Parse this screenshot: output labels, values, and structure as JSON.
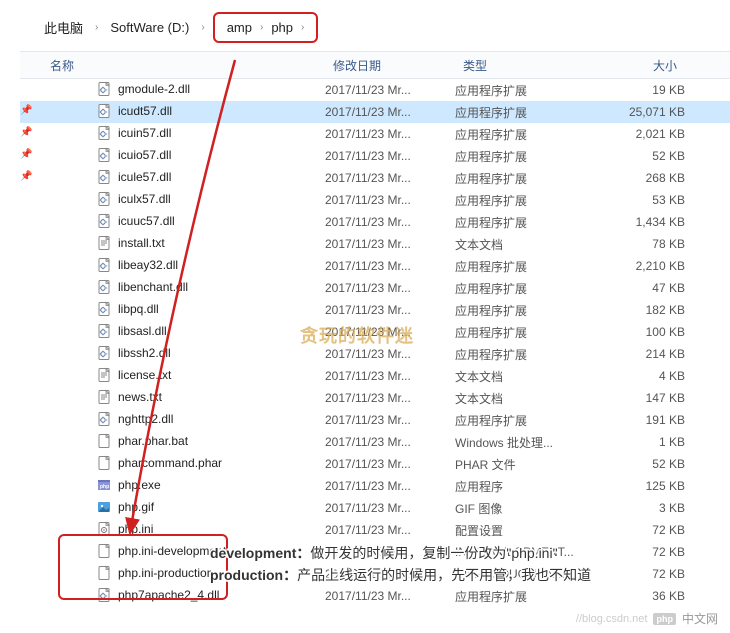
{
  "breadcrumb": {
    "items": [
      "此电脑",
      "SoftWare (D:)",
      "amp",
      "php"
    ]
  },
  "columns": {
    "name": "名称",
    "date": "修改日期",
    "type": "类型",
    "size": "大小"
  },
  "files": [
    {
      "pin": false,
      "icon": "dll",
      "name": "gmodule-2.dll",
      "date": "2017/11/23 Mr...",
      "type": "应用程序扩展",
      "size": "19 KB",
      "selected": false
    },
    {
      "pin": true,
      "icon": "dll",
      "name": "icudt57.dll",
      "date": "2017/11/23 Mr...",
      "type": "应用程序扩展",
      "size": "25,071 KB",
      "selected": true
    },
    {
      "pin": true,
      "icon": "dll",
      "name": "icuin57.dll",
      "date": "2017/11/23 Mr...",
      "type": "应用程序扩展",
      "size": "2,021 KB",
      "selected": false
    },
    {
      "pin": true,
      "icon": "dll",
      "name": "icuio57.dll",
      "date": "2017/11/23 Mr...",
      "type": "应用程序扩展",
      "size": "52 KB",
      "selected": false
    },
    {
      "pin": true,
      "icon": "dll",
      "name": "icule57.dll",
      "date": "2017/11/23 Mr...",
      "type": "应用程序扩展",
      "size": "268 KB",
      "selected": false
    },
    {
      "pin": false,
      "icon": "dll",
      "name": "iculx57.dll",
      "date": "2017/11/23 Mr...",
      "type": "应用程序扩展",
      "size": "53 KB",
      "selected": false
    },
    {
      "pin": false,
      "icon": "dll",
      "name": "icuuc57.dll",
      "date": "2017/11/23 Mr...",
      "type": "应用程序扩展",
      "size": "1,434 KB",
      "selected": false
    },
    {
      "pin": false,
      "icon": "txt",
      "name": "install.txt",
      "date": "2017/11/23 Mr...",
      "type": "文本文档",
      "size": "78 KB",
      "selected": false
    },
    {
      "pin": false,
      "icon": "dll",
      "name": "libeay32.dll",
      "date": "2017/11/23 Mr...",
      "type": "应用程序扩展",
      "size": "2,210 KB",
      "selected": false
    },
    {
      "pin": false,
      "icon": "dll",
      "name": "libenchant.dll",
      "date": "2017/11/23 Mr...",
      "type": "应用程序扩展",
      "size": "47 KB",
      "selected": false
    },
    {
      "pin": false,
      "icon": "dll",
      "name": "libpq.dll",
      "date": "2017/11/23 Mr...",
      "type": "应用程序扩展",
      "size": "182 KB",
      "selected": false
    },
    {
      "pin": false,
      "icon": "dll",
      "name": "libsasl.dll",
      "date": "2017/11/23 Mr...",
      "type": "应用程序扩展",
      "size": "100 KB",
      "selected": false
    },
    {
      "pin": false,
      "icon": "dll",
      "name": "libssh2.dll",
      "date": "2017/11/23 Mr...",
      "type": "应用程序扩展",
      "size": "214 KB",
      "selected": false
    },
    {
      "pin": false,
      "icon": "txt",
      "name": "license.txt",
      "date": "2017/11/23 Mr...",
      "type": "文本文档",
      "size": "4 KB",
      "selected": false
    },
    {
      "pin": false,
      "icon": "txt",
      "name": "news.txt",
      "date": "2017/11/23 Mr...",
      "type": "文本文档",
      "size": "147 KB",
      "selected": false
    },
    {
      "pin": false,
      "icon": "dll",
      "name": "nghttp2.dll",
      "date": "2017/11/23 Mr...",
      "type": "应用程序扩展",
      "size": "191 KB",
      "selected": false
    },
    {
      "pin": false,
      "icon": "file",
      "name": "phar.phar.bat",
      "date": "2017/11/23 Mr...",
      "type": "Windows 批处理...",
      "size": "1 KB",
      "selected": false
    },
    {
      "pin": false,
      "icon": "phar",
      "name": "pharcommand.phar",
      "date": "2017/11/23 Mr...",
      "type": "PHAR 文件",
      "size": "52 KB",
      "selected": false
    },
    {
      "pin": false,
      "icon": "exe",
      "name": "php.exe",
      "date": "2017/11/23 Mr...",
      "type": "应用程序",
      "size": "125 KB",
      "selected": false
    },
    {
      "pin": false,
      "icon": "gif",
      "name": "php.gif",
      "date": "2017/11/23 Mr...",
      "type": "GIF 图像",
      "size": "3 KB",
      "selected": false
    },
    {
      "pin": false,
      "icon": "ini",
      "name": "php.ini",
      "date": "2017/11/23 Mr...",
      "type": "配置设置",
      "size": "72 KB",
      "selected": false
    },
    {
      "pin": false,
      "icon": "file",
      "name": "php.ini-development",
      "date": "2017/11/23 Mr...",
      "type": "INI-DEVELOPMENT...",
      "size": "72 KB",
      "selected": false
    },
    {
      "pin": false,
      "icon": "file",
      "name": "php.ini-production",
      "date": "2017/11/23 Mr...",
      "type": "INI-PRODUCTION...",
      "size": "72 KB",
      "selected": false
    },
    {
      "pin": false,
      "icon": "dll",
      "name": "php7apache2_4.dll",
      "date": "2017/11/23 Mr...",
      "type": "应用程序扩展",
      "size": "36 KB",
      "selected": false
    }
  ],
  "watermark": "贪玩的软件迷",
  "caption": {
    "line1_key": "development：",
    "line1_val": "做开发的时候用，复制一份改为\"php.ini\"",
    "line2_key": "production：",
    "line2_val": "产品上线运行的时候用，先不用管，我也不知道"
  },
  "footer": {
    "blog": "//blog.csdn.net",
    "logo": "php",
    "site": "中文网"
  }
}
